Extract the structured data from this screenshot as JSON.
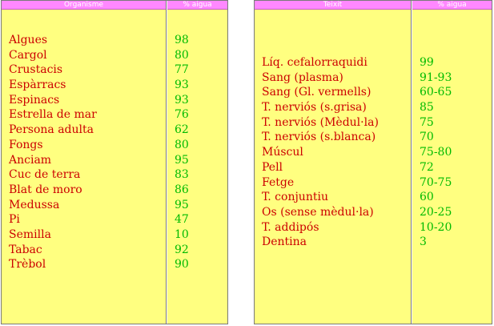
{
  "left_table": {
    "header_name": "Organisme",
    "header_value": "% aigua",
    "rows": [
      {
        "name": "Algues",
        "value": "98"
      },
      {
        "name": "Cargol",
        "value": "80"
      },
      {
        "name": "Crustacis",
        "value": "77"
      },
      {
        "name": "Espàrracs",
        "value": "93"
      },
      {
        "name": "Espinacs",
        "value": "93"
      },
      {
        "name": "Estrella de mar",
        "value": "76"
      },
      {
        "name": "Persona adulta",
        "value": "62"
      },
      {
        "name": "Fongs",
        "value": "80"
      },
      {
        "name": "Anciam",
        "value": "95"
      },
      {
        "name": "Cuc de terra",
        "value": "83"
      },
      {
        "name": "Blat de moro",
        "value": "86"
      },
      {
        "name": "Medussa",
        "value": "95"
      },
      {
        "name": "Pi",
        "value": "47"
      },
      {
        "name": "Semilla",
        "value": "10"
      },
      {
        "name": "Tabac",
        "value": "92"
      },
      {
        "name": "Trèbol",
        "value": "90"
      }
    ]
  },
  "right_table": {
    "header_name": "Teixit",
    "header_value": "% aigua",
    "rows": [
      {
        "name": "Líq. cefalorraquidi",
        "value": "99"
      },
      {
        "name": "Sang (plasma)",
        "value": "91-93"
      },
      {
        "name": "Sang (Gl. vermells)",
        "value": "60-65"
      },
      {
        "name": "T. nerviós (s.grisa)",
        "value": "85"
      },
      {
        "name": "T. nerviós (Mèdul·la)",
        "value": "75"
      },
      {
        "name": "T. nerviós (s.blanca)",
        "value": "70"
      },
      {
        "name": "Múscul",
        "value": "75-80"
      },
      {
        "name": "Pell",
        "value": "72"
      },
      {
        "name": "Fetge",
        "value": "70-75"
      },
      {
        "name": "T. conjuntiu",
        "value": "60"
      },
      {
        "name": "Os (sense mèdul·la)",
        "value": "20-25"
      },
      {
        "name": "T. addipós",
        "value": "10-20"
      },
      {
        "name": "Dentina",
        "value": "3"
      }
    ]
  }
}
